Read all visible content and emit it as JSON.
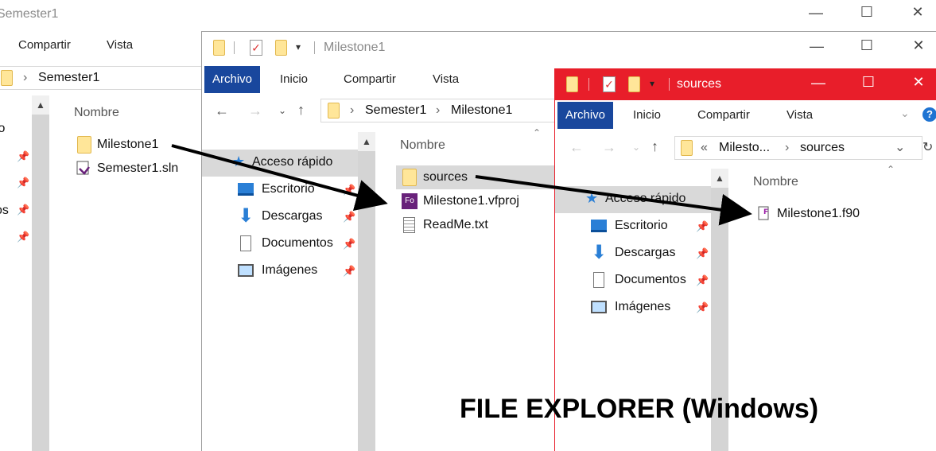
{
  "colors": {
    "archivo_tab": "#19479d",
    "active_titlebar": "#e81e2a",
    "folder": "#ffe699",
    "selection": "#d9d9d9",
    "drive_blue": "#2a7fd6"
  },
  "win1": {
    "title": "Semester1",
    "ribbon": [
      "Compartir",
      "Vista"
    ],
    "address": [
      "Semester1"
    ],
    "column": "Nombre",
    "side_partial": [
      "lo",
      "os"
    ],
    "files": [
      "Milestone1",
      "Semester1.sln"
    ]
  },
  "win2": {
    "title": "Milestone1",
    "ribbon": [
      "Archivo",
      "Inicio",
      "Compartir",
      "Vista"
    ],
    "address": [
      "Semester1",
      "Milestone1"
    ],
    "column": "Nombre",
    "quick_access": "Acceso rápido",
    "side": [
      "Escritorio",
      "Descargas",
      "Documentos",
      "Imágenes"
    ],
    "files": [
      "sources",
      "Milestone1.vfproj",
      "ReadMe.txt"
    ]
  },
  "win3": {
    "title": "sources",
    "ribbon": [
      "Archivo",
      "Inicio",
      "Compartir",
      "Vista"
    ],
    "address": [
      "«",
      "Milesto...",
      "sources"
    ],
    "column": "Nombre",
    "quick_access": "Acceso rápido",
    "side": [
      "Escritorio",
      "Descargas",
      "Documentos",
      "Imágenes"
    ],
    "files": [
      "Milestone1.f90"
    ]
  },
  "caption": "FILE EXPLORER (Windows)",
  "icons": {
    "minimize": "minimize-icon",
    "maximize": "maximize-icon",
    "close": "close-icon",
    "back": "back-arrow-icon",
    "forward": "forward-arrow-icon",
    "up": "up-arrow-icon",
    "refresh": "refresh-icon",
    "help": "help-icon"
  }
}
